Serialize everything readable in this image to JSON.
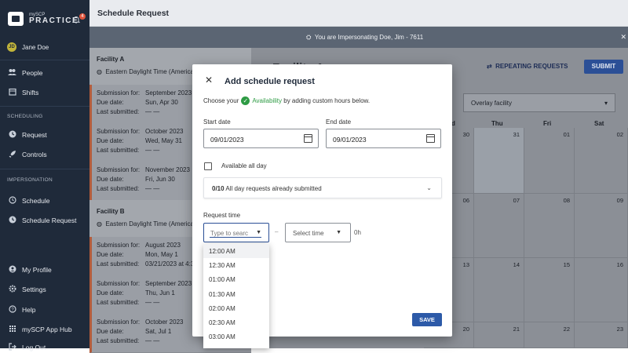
{
  "sidebar": {
    "logo_small": "mySCP",
    "logo_big": "PRACTICE",
    "notification_count": "4",
    "user_initials": "JD",
    "user_name": "Jane Doe",
    "items_main": [
      {
        "label": "People",
        "icon": "people-icon"
      },
      {
        "label": "Shifts",
        "icon": "calendar-icon"
      }
    ],
    "section_scheduling": "SCHEDULING",
    "items_scheduling": [
      {
        "label": "Request",
        "icon": "request-icon"
      },
      {
        "label": "Controls",
        "icon": "rocket-icon"
      }
    ],
    "section_impersonation": "IMPERSONATION",
    "items_impersonation": [
      {
        "label": "Schedule",
        "icon": "clock-icon"
      },
      {
        "label": "Schedule Request",
        "icon": "request-icon"
      }
    ],
    "items_bottom": [
      {
        "label": "My Profile",
        "icon": "person-icon"
      },
      {
        "label": "Settings",
        "icon": "gear-icon"
      },
      {
        "label": "Help",
        "icon": "help-icon"
      },
      {
        "label": "mySCP App Hub",
        "icon": "grid-icon"
      },
      {
        "label": "Log Out",
        "icon": "logout-icon"
      }
    ]
  },
  "header": {
    "title": "Schedule Request",
    "impersonation_text": "You are Impersonating Doe, Jim - 7611"
  },
  "facilities": [
    {
      "name": "Facility A",
      "timezone": "Eastern Daylight Time (America",
      "submissions": [
        {
          "submission_for": "September 2023",
          "due_date": "Sun, Apr 30",
          "last_submitted": "— —"
        },
        {
          "submission_for": "October 2023",
          "due_date": "Wed, May 31",
          "last_submitted": "— —"
        },
        {
          "submission_for": "November 2023",
          "due_date": "Fri, Jun 30",
          "last_submitted": "— —"
        }
      ]
    },
    {
      "name": "Facility B",
      "timezone": "Eastern Daylight Time (America",
      "submissions": [
        {
          "submission_for": "August 2023",
          "due_date": "Mon, May 1",
          "last_submitted": "03/21/2023 at 4:3"
        },
        {
          "submission_for": "September 2023",
          "due_date": "Thu, Jun 1",
          "last_submitted": "— —"
        },
        {
          "submission_for": "October 2023",
          "due_date": "Sat, Jul 1",
          "last_submitted": "— —"
        }
      ]
    }
  ],
  "labels": {
    "submission_for": "Submission for:",
    "due_date": "Due date:",
    "last_submitted": "Last submitted:"
  },
  "calendar": {
    "title": "Facility A",
    "repeating_label": "REPEATING REQUESTS",
    "submit_label": "SUBMIT",
    "overlay_label": "Overlay facility",
    "day_headers": [
      "d",
      "Thu",
      "Fri",
      "Sat"
    ],
    "rows": [
      [
        "30",
        "31",
        "01",
        "02"
      ],
      [
        "06",
        "07",
        "08",
        "09"
      ],
      [
        "13",
        "14",
        "15",
        "16"
      ],
      [
        "20",
        "21",
        "22",
        "23"
      ]
    ]
  },
  "modal": {
    "title": "Add schedule request",
    "intro_before": "Choose your",
    "intro_link": "Availability",
    "intro_after": "by adding custom hours below.",
    "start_label": "Start date",
    "start_value": "09/01/2023",
    "end_label": "End date",
    "end_value": "09/01/2023",
    "all_day_label": "Available all day",
    "accordion_bold": "0/10",
    "accordion_text": "All day requests already submitted",
    "request_time_label": "Request time",
    "start_time_placeholder": "Type to searc",
    "end_time_placeholder": "Select time",
    "dash": "–",
    "duration": "0h",
    "save_label": "SAVE"
  },
  "time_options": [
    "12:00 AM",
    "12:30 AM",
    "01:00 AM",
    "01:30 AM",
    "02:00 AM",
    "02:30 AM",
    "03:00 AM"
  ]
}
